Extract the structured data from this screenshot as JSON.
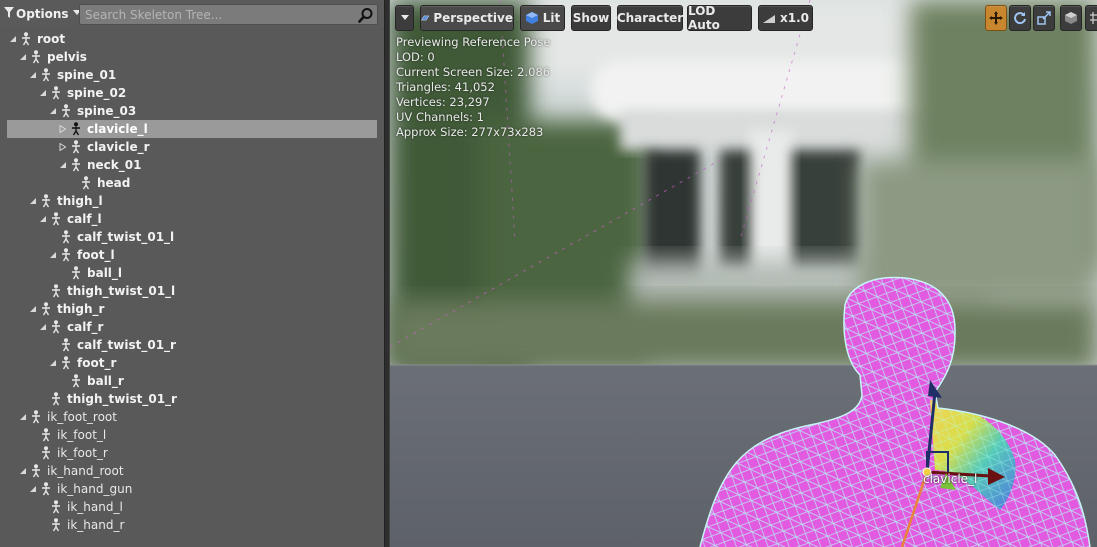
{
  "tree_toolbar": {
    "options_label": "Options",
    "search_placeholder": "Search Skeleton Tree..."
  },
  "tree": [
    {
      "label": "root",
      "depth": 0,
      "expander": "collapse",
      "bold": true,
      "selected": false
    },
    {
      "label": "pelvis",
      "depth": 1,
      "expander": "collapse",
      "bold": true,
      "selected": false
    },
    {
      "label": "spine_01",
      "depth": 2,
      "expander": "collapse",
      "bold": true,
      "selected": false
    },
    {
      "label": "spine_02",
      "depth": 3,
      "expander": "collapse",
      "bold": true,
      "selected": false
    },
    {
      "label": "spine_03",
      "depth": 4,
      "expander": "collapse",
      "bold": true,
      "selected": false
    },
    {
      "label": "clavicle_l",
      "depth": 5,
      "expander": "expand",
      "bold": true,
      "selected": true
    },
    {
      "label": "clavicle_r",
      "depth": 5,
      "expander": "expand",
      "bold": true,
      "selected": false
    },
    {
      "label": "neck_01",
      "depth": 5,
      "expander": "collapse",
      "bold": true,
      "selected": false
    },
    {
      "label": "head",
      "depth": 6,
      "expander": "none",
      "bold": true,
      "selected": false
    },
    {
      "label": "thigh_l",
      "depth": 2,
      "expander": "collapse",
      "bold": true,
      "selected": false
    },
    {
      "label": "calf_l",
      "depth": 3,
      "expander": "collapse",
      "bold": true,
      "selected": false
    },
    {
      "label": "calf_twist_01_l",
      "depth": 4,
      "expander": "none",
      "bold": true,
      "selected": false
    },
    {
      "label": "foot_l",
      "depth": 4,
      "expander": "collapse",
      "bold": true,
      "selected": false
    },
    {
      "label": "ball_l",
      "depth": 5,
      "expander": "none",
      "bold": true,
      "selected": false
    },
    {
      "label": "thigh_twist_01_l",
      "depth": 3,
      "expander": "none",
      "bold": true,
      "selected": false
    },
    {
      "label": "thigh_r",
      "depth": 2,
      "expander": "collapse",
      "bold": true,
      "selected": false
    },
    {
      "label": "calf_r",
      "depth": 3,
      "expander": "collapse",
      "bold": true,
      "selected": false
    },
    {
      "label": "calf_twist_01_r",
      "depth": 4,
      "expander": "none",
      "bold": true,
      "selected": false
    },
    {
      "label": "foot_r",
      "depth": 4,
      "expander": "collapse",
      "bold": true,
      "selected": false
    },
    {
      "label": "ball_r",
      "depth": 5,
      "expander": "none",
      "bold": true,
      "selected": false
    },
    {
      "label": "thigh_twist_01_r",
      "depth": 3,
      "expander": "none",
      "bold": true,
      "selected": false
    },
    {
      "label": "ik_foot_root",
      "depth": 1,
      "expander": "collapse",
      "bold": false,
      "selected": false
    },
    {
      "label": "ik_foot_l",
      "depth": 2,
      "expander": "none",
      "bold": false,
      "selected": false
    },
    {
      "label": "ik_foot_r",
      "depth": 2,
      "expander": "none",
      "bold": false,
      "selected": false
    },
    {
      "label": "ik_hand_root",
      "depth": 1,
      "expander": "collapse",
      "bold": false,
      "selected": false
    },
    {
      "label": "ik_hand_gun",
      "depth": 2,
      "expander": "collapse",
      "bold": false,
      "selected": false
    },
    {
      "label": "ik_hand_l",
      "depth": 3,
      "expander": "none",
      "bold": false,
      "selected": false
    },
    {
      "label": "ik_hand_r",
      "depth": 3,
      "expander": "none",
      "bold": false,
      "selected": false
    }
  ],
  "viewport_toolbar": {
    "perspective_label": "Perspective",
    "lit_label": "Lit",
    "show_label": "Show",
    "character_label": "Character",
    "lod_label": "LOD Auto",
    "speed_label": "x1.0"
  },
  "stats": {
    "line1": "Previewing Reference Pose",
    "line2": "LOD: 0",
    "line3": "Current Screen Size: 2.086",
    "line4": "Triangles: 41,052",
    "line5": "Vertices: 23,297",
    "line6": "UV Channels: 1",
    "line7": "Approx Size: 277x73x283"
  },
  "selected_bone_tag": "clavicle_l",
  "colors": {
    "mesh": "#e25ae0",
    "wire": "#a9e9ef",
    "selection": "#9a9a9a",
    "panel": "#595959",
    "gizmo_active": "#e8a040"
  }
}
